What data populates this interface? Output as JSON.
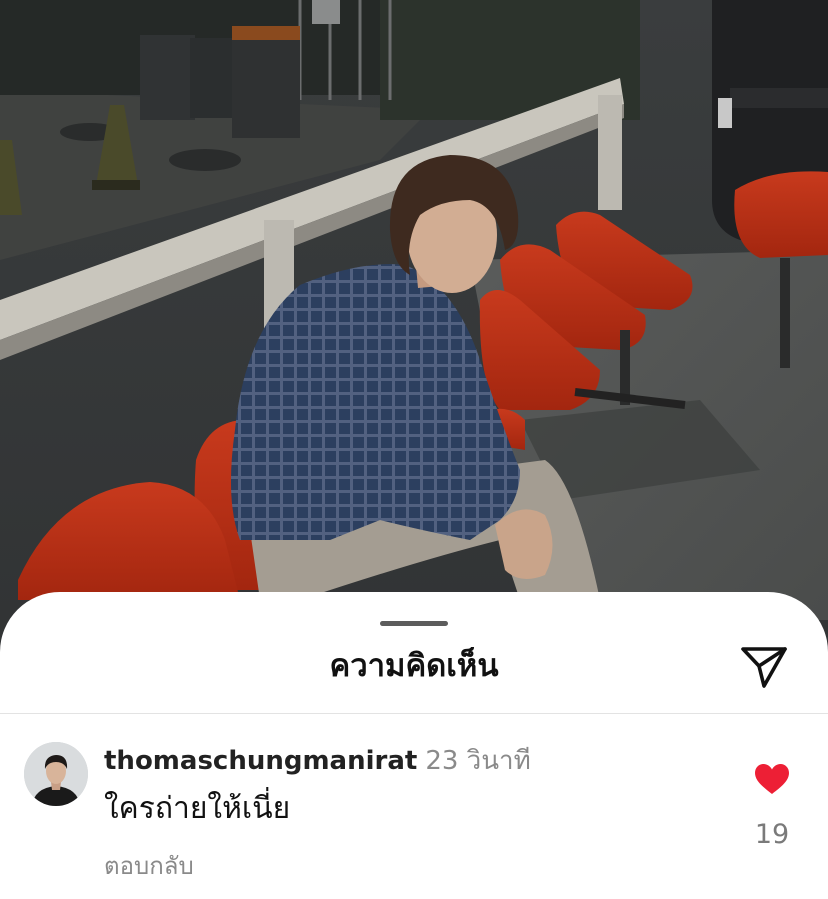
{
  "comments_sheet": {
    "title": "ความคิดเห็น",
    "send_icon": "paper-plane-icon"
  },
  "comment": {
    "avatar_icon": "profile-avatar",
    "username": "thomaschungmanirat",
    "timestamp": "23 วินาที",
    "text": "ใครถ่ายให้เนี่ย",
    "reply_label": "ตอบกลับ",
    "like_icon": "heart-filled-icon",
    "like_count": "19",
    "liked": true
  },
  "colors": {
    "like_red": "#ed1f35",
    "sheet_background": "#ffffff",
    "muted_text": "#8a8a8a",
    "primary_text": "#111111",
    "chair_orange": "#c8361a"
  }
}
